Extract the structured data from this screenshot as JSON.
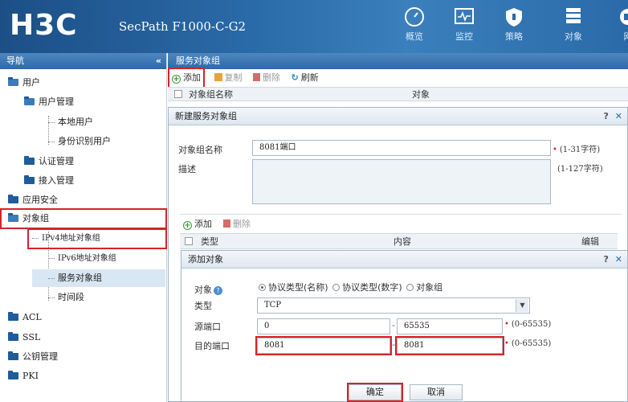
{
  "header": {
    "logo": "H3C",
    "product": "SecPath F1000-C-G2",
    "nav": [
      {
        "label": "概览",
        "icon": "dashboard-icon"
      },
      {
        "label": "监控",
        "icon": "monitor-icon"
      },
      {
        "label": "策略",
        "icon": "shield-icon"
      },
      {
        "label": "对象",
        "icon": "object-icon"
      },
      {
        "label": "网",
        "icon": "network-icon"
      }
    ]
  },
  "sidebar": {
    "title": "导航",
    "collapse": "«",
    "items": [
      {
        "label": "用户"
      },
      {
        "label": "用户管理"
      },
      {
        "label": "本地用户"
      },
      {
        "label": "身份识别用户"
      },
      {
        "label": "认证管理"
      },
      {
        "label": "接入管理"
      },
      {
        "label": "应用安全"
      },
      {
        "label": "对象组"
      },
      {
        "label": "IPv4地址对象组"
      },
      {
        "label": "IPv6地址对象组"
      },
      {
        "label": "服务对象组"
      },
      {
        "label": "时间段"
      },
      {
        "label": "ACL"
      },
      {
        "label": "SSL"
      },
      {
        "label": "公钥管理"
      },
      {
        "label": "PKI"
      }
    ]
  },
  "main": {
    "title": "服务对象组",
    "toolbar": {
      "add": "添加",
      "copy": "复制",
      "delete": "删除",
      "refresh": "刷新"
    },
    "columns": {
      "name": "对象组名称",
      "object": "对象"
    }
  },
  "dialog1": {
    "title": "新建服务对象组",
    "controls": {
      "help": "?",
      "close": "✕"
    },
    "name_label": "对象组名称",
    "name_value": "8081端口",
    "name_hint": "(1-31字符)",
    "desc_label": "描述",
    "desc_hint": "(1-127字符)",
    "toolbar": {
      "add": "添加",
      "delete": "删除"
    },
    "columns": {
      "type": "类型",
      "content": "内容",
      "edit": "编辑"
    }
  },
  "dialog2": {
    "title": "添加对象",
    "controls": {
      "help": "?",
      "close": "✕"
    },
    "object_label": "对象",
    "radio_options": [
      "协议类型(名称)",
      "协议类型(数字)",
      "对象组"
    ],
    "type_label": "类型",
    "type_value": "TCP",
    "src_label": "源端口",
    "src_from": "0",
    "src_to": "65535",
    "src_hint": "(0-65535)",
    "dst_label": "目的端口",
    "dst_from": "8081",
    "dst_to": "8081",
    "dst_hint": "(0-65535)",
    "ok": "确定",
    "cancel": "取消"
  }
}
